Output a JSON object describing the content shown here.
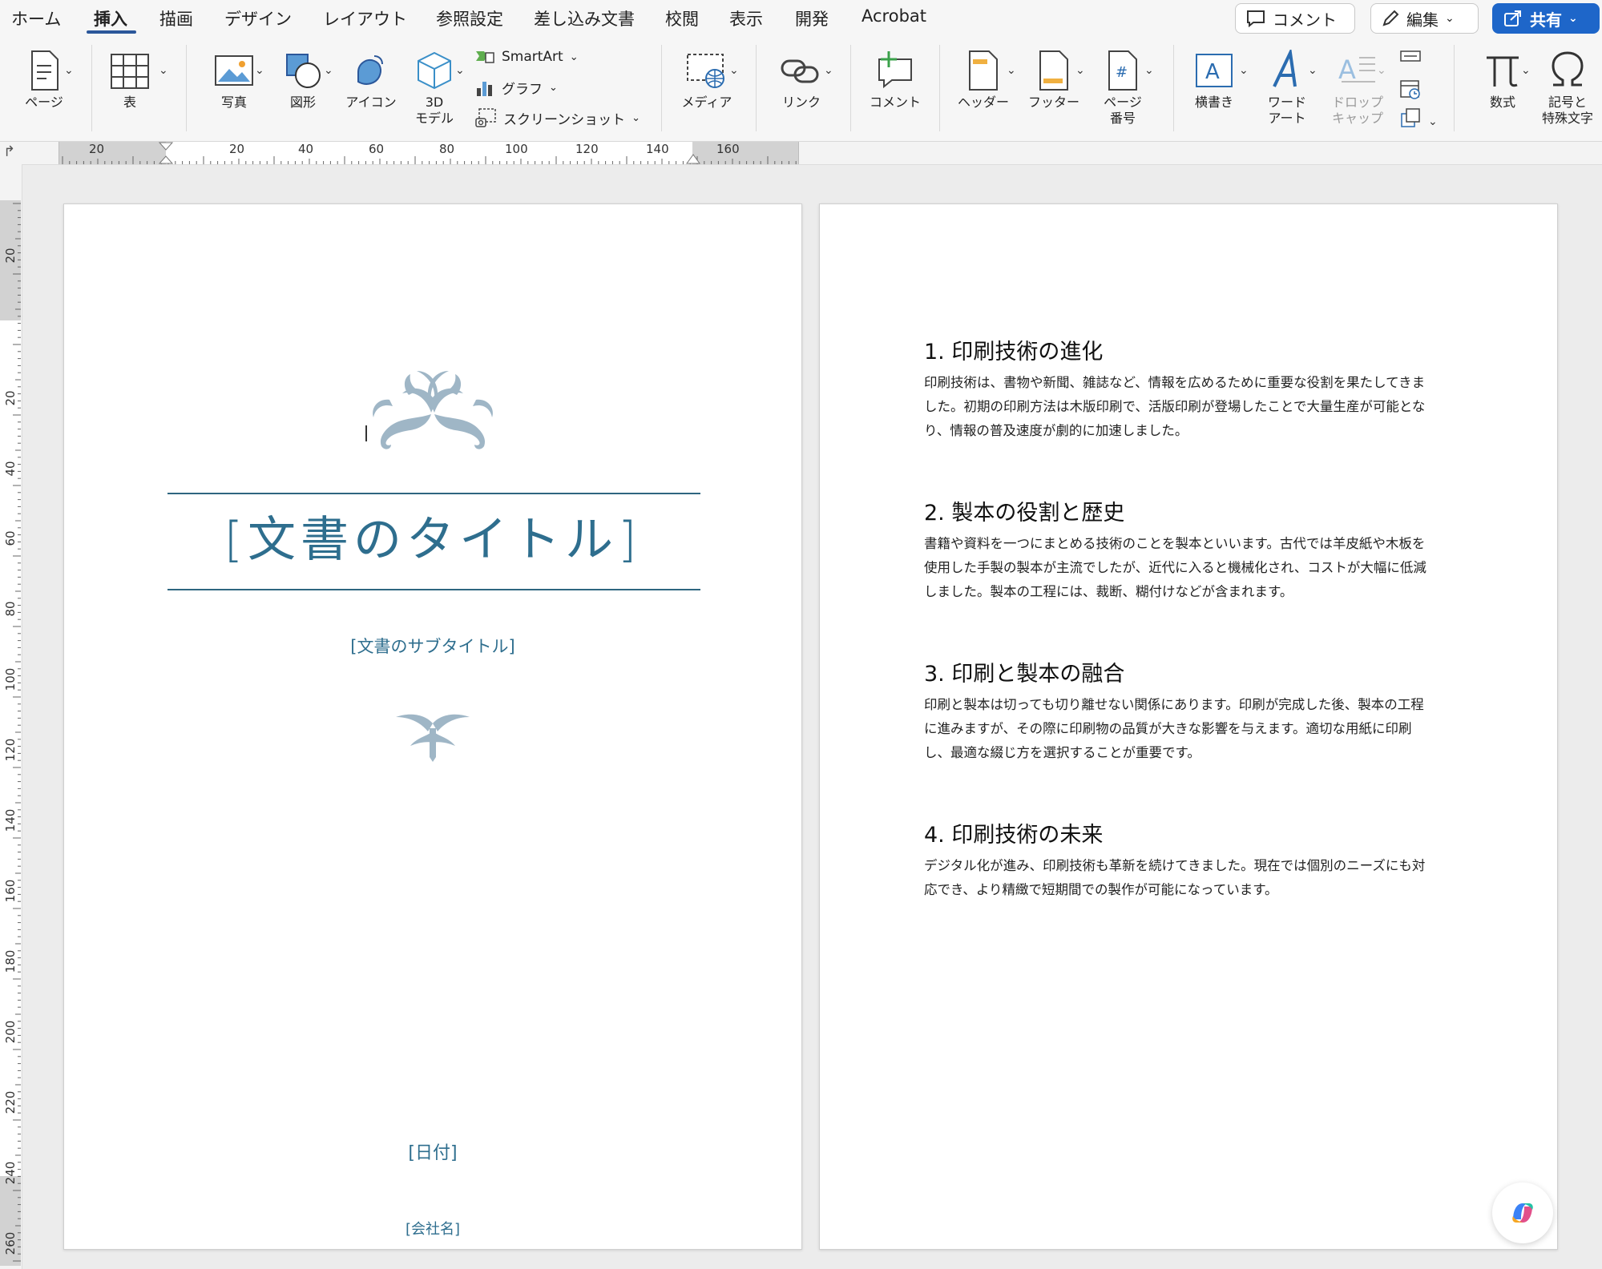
{
  "menu_tabs": [
    {
      "label": "ホーム",
      "active": false
    },
    {
      "label": "挿入",
      "active": true
    },
    {
      "label": "描画",
      "active": false
    },
    {
      "label": "デザイン",
      "active": false
    },
    {
      "label": "レイアウト",
      "active": false
    },
    {
      "label": "参照設定",
      "active": false
    },
    {
      "label": "差し込み文書",
      "active": false
    },
    {
      "label": "校閲",
      "active": false
    },
    {
      "label": "表示",
      "active": false
    },
    {
      "label": "開発",
      "active": false
    },
    {
      "label": "Acrobat",
      "active": false
    }
  ],
  "top_right": {
    "comment": "コメント",
    "edit": "編集",
    "share": "共有"
  },
  "ribbon": {
    "page": "ページ",
    "table": "表",
    "photo": "写真",
    "shapes": "図形",
    "icons": "アイコン",
    "model3d_line1": "3D",
    "model3d_line2": "モデル",
    "smartart": "SmartArt",
    "chart": "グラフ",
    "screenshot": "スクリーンショット",
    "media": "メディア",
    "link": "リンク",
    "comment": "コメント",
    "header": "ヘッダー",
    "footer": "フッター",
    "page_number_line1": "ページ",
    "page_number_line2": "番号",
    "textbox": "横書き",
    "wordart_line1": "ワード",
    "wordart_line2": "アート",
    "dropcap_line1": "ドロップ",
    "dropcap_line2": "キャップ",
    "equation": "数式",
    "symbol_line1": "記号と",
    "symbol_line2": "特殊文字"
  },
  "ruler": {
    "h_numbers": [
      "20",
      "20",
      "40",
      "60",
      "80",
      "100",
      "120",
      "140",
      "160"
    ],
    "v_numbers": [
      "20",
      "20",
      "40",
      "60",
      "80",
      "100",
      "120",
      "140",
      "160",
      "180",
      "200",
      "220",
      "240",
      "260"
    ]
  },
  "cover": {
    "title": "[文書のタイトル]",
    "subtitle": "[文書のサブタイトル]",
    "date": "[日付]",
    "company": "[会社名]"
  },
  "sections": [
    {
      "heading": "1. 印刷技術の進化",
      "lines": [
        "印刷技術は、書物や新聞、雑誌など、情報を広めるために重要な役割を果たしてきま",
        "した。初期の印刷方法は木版印刷で、活版印刷が登場したことで大量生産が可能とな",
        "り、情報の普及速度が劇的に加速しました。"
      ]
    },
    {
      "heading": "2. 製本の役割と歴史",
      "lines": [
        "書籍や資料を一つにまとめる技術のことを製本といいます。古代では羊皮紙や木板を",
        "使用した手製の製本が主流でしたが、近代に入ると機械化され、コストが大幅に低減",
        "しました。製本の工程には、裁断、糊付けなどが含まれます。"
      ]
    },
    {
      "heading": "3. 印刷と製本の融合",
      "lines": [
        "印刷と製本は切っても切り離せない関係にあります。印刷が完成した後、製本の工程",
        "に進みますが、その際に印刷物の品質が大きな影響を与えます。適切な用紙に印刷",
        "し、最適な綴じ方を選択することが重要です。"
      ]
    },
    {
      "heading": "4. 印刷技術の未来",
      "lines": [
        "デジタル化が進み、印刷技術も革新を続けてきました。現在では個別のニーズにも対",
        "応でき、より精緻で短期間での製作が可能になっています。"
      ]
    }
  ],
  "colors": {
    "accent": "#2b579a",
    "title": "#2e6e8e",
    "ornament": "#9fb6c6",
    "share": "#1e66c9"
  }
}
